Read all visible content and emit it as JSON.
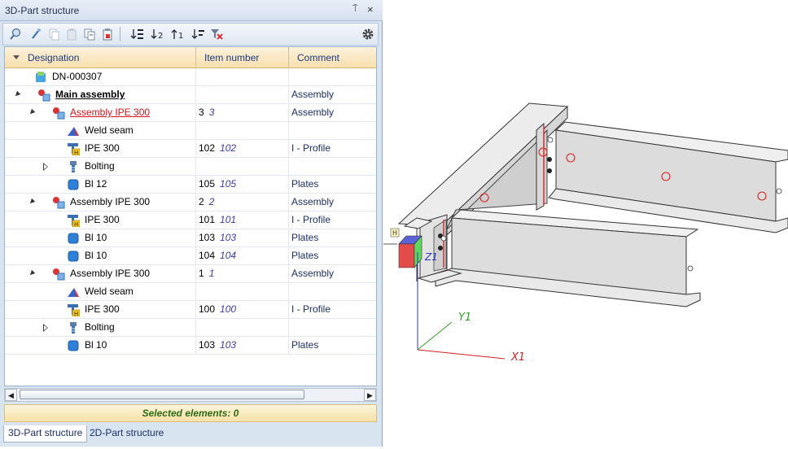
{
  "panel": {
    "title": "3D-Part structure",
    "pin_glyph": "⍑",
    "close_glyph": "×"
  },
  "toolbar": {
    "icons": [
      "search-icon",
      "brush-icon",
      "copy-icon",
      "paste-icon",
      "copy-to-icon",
      "paste-to-icon",
      "sort-item-asc-icon",
      "sort-down-2-icon",
      "sort-up-1-icon",
      "sort-list-icon",
      "filter-clear-icon",
      "gear-icon"
    ]
  },
  "columns": {
    "designation": "Designation",
    "item_number": "Item number",
    "comment": "Comment"
  },
  "rows": [
    {
      "label": "DN-000307",
      "item": "",
      "item_italic": "",
      "comment": "",
      "icon": "drawing-icon"
    },
    {
      "label": "Main assembly",
      "item": "",
      "item_italic": "",
      "comment": "Assembly",
      "icon": "assembly-icon"
    },
    {
      "label": "Assembly IPE 300",
      "item": "3",
      "item_italic": "3",
      "comment": "Assembly",
      "icon": "assembly-icon"
    },
    {
      "label": "Weld seam",
      "item": "",
      "item_italic": "",
      "comment": "",
      "icon": "weld-icon"
    },
    {
      "label": "IPE 300",
      "item": "102",
      "item_italic": "102",
      "comment": "I - Profile",
      "icon": "beam-icon"
    },
    {
      "label": "Bolting",
      "item": "",
      "item_italic": "",
      "comment": "",
      "icon": "bolt-icon"
    },
    {
      "label": "Bl 12",
      "item": "105",
      "item_italic": "105",
      "comment": "Plates",
      "icon": "plate-icon"
    },
    {
      "label": "Assembly IPE 300",
      "item": "2",
      "item_italic": "2",
      "comment": "Assembly",
      "icon": "assembly-icon"
    },
    {
      "label": "IPE 300",
      "item": "101",
      "item_italic": "101",
      "comment": "I - Profile",
      "icon": "beam-icon"
    },
    {
      "label": "Bl 10",
      "item": "103",
      "item_italic": "103",
      "comment": "Plates",
      "icon": "plate-icon"
    },
    {
      "label": "Bl 10",
      "item": "104",
      "item_italic": "104",
      "comment": "Plates",
      "icon": "plate-icon"
    },
    {
      "label": "Assembly IPE 300",
      "item": "1",
      "item_italic": "1",
      "comment": "Assembly",
      "icon": "assembly-icon"
    },
    {
      "label": "Weld seam",
      "item": "",
      "item_italic": "",
      "comment": "",
      "icon": "weld-icon"
    },
    {
      "label": "IPE 300",
      "item": "100",
      "item_italic": "100",
      "comment": "I - Profile",
      "icon": "beam-icon"
    },
    {
      "label": "Bolting",
      "item": "",
      "item_italic": "",
      "comment": "",
      "icon": "bolt-icon"
    },
    {
      "label": "Bl 10",
      "item": "103",
      "item_italic": "103",
      "comment": "Plates",
      "icon": "plate-icon"
    }
  ],
  "scrollbar": {
    "left_glyph": "◀",
    "right_glyph": "▶"
  },
  "status": {
    "text": "Selected elements: 0"
  },
  "tabs": [
    "3D-Part structure",
    "2D-Part structure"
  ],
  "viewport": {
    "axis_x": "X1",
    "axis_y": "Y1",
    "axis_z": "Z1",
    "cube_label": "H",
    "colors": {
      "axis_x": "#d22020",
      "axis_y": "#35a02a",
      "axis_z": "#2a34c8",
      "steel": "#e6e6e6",
      "highlight": "#e02020"
    }
  }
}
